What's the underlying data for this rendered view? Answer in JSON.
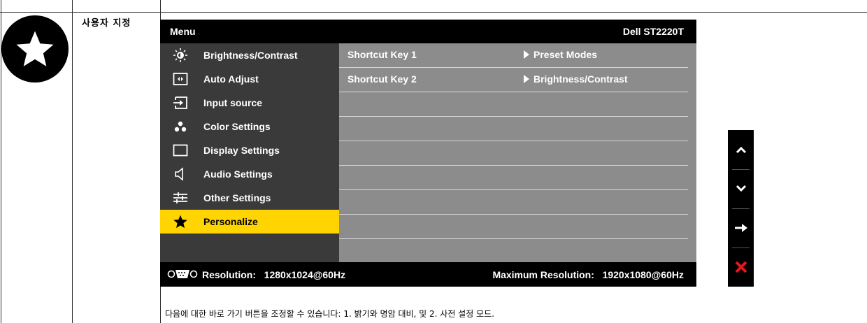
{
  "section": {
    "title": "사용자 지정"
  },
  "osd": {
    "title": "Menu",
    "model": "Dell ST2220T",
    "menu": [
      {
        "label": "Brightness/Contrast",
        "icon": "brightness-icon"
      },
      {
        "label": "Auto Adjust",
        "icon": "auto-adjust-icon"
      },
      {
        "label": "Input source",
        "icon": "input-source-icon"
      },
      {
        "label": "Color Settings",
        "icon": "color-settings-icon"
      },
      {
        "label": "Display Settings",
        "icon": "display-settings-icon"
      },
      {
        "label": "Audio Settings",
        "icon": "audio-settings-icon"
      },
      {
        "label": "Other Settings",
        "icon": "other-settings-icon"
      },
      {
        "label": "Personalize",
        "icon": "star-icon",
        "active": true
      }
    ],
    "rows": [
      {
        "key": "Shortcut Key 1",
        "value": "Preset Modes"
      },
      {
        "key": "Shortcut Key 2",
        "value": "Brightness/Contrast"
      },
      {
        "key": "",
        "value": ""
      },
      {
        "key": "",
        "value": ""
      },
      {
        "key": "",
        "value": ""
      },
      {
        "key": "",
        "value": ""
      },
      {
        "key": "",
        "value": ""
      },
      {
        "key": "",
        "value": ""
      },
      {
        "key": "",
        "value": ""
      }
    ],
    "resolution_label": "Resolution:",
    "resolution_value": "1280x1024@60Hz",
    "max_resolution_label": "Maximum Resolution:",
    "max_resolution_value": "1920x1080@60Hz"
  },
  "nav_buttons": [
    {
      "name": "up-arrow-icon"
    },
    {
      "name": "down-arrow-icon"
    },
    {
      "name": "right-arrow-icon"
    },
    {
      "name": "close-icon"
    }
  ],
  "caption": "다음에 대한 바로 가기 버튼을 조정할 수 있습니다: 1. 밝기와 명암 대비, 및 2. 사전 설정 모드.",
  "colors": {
    "highlight": "#ffd400",
    "exit": "#e8141c",
    "panel_left": "#3a3a3a",
    "panel_right": "#8c8c8c"
  }
}
